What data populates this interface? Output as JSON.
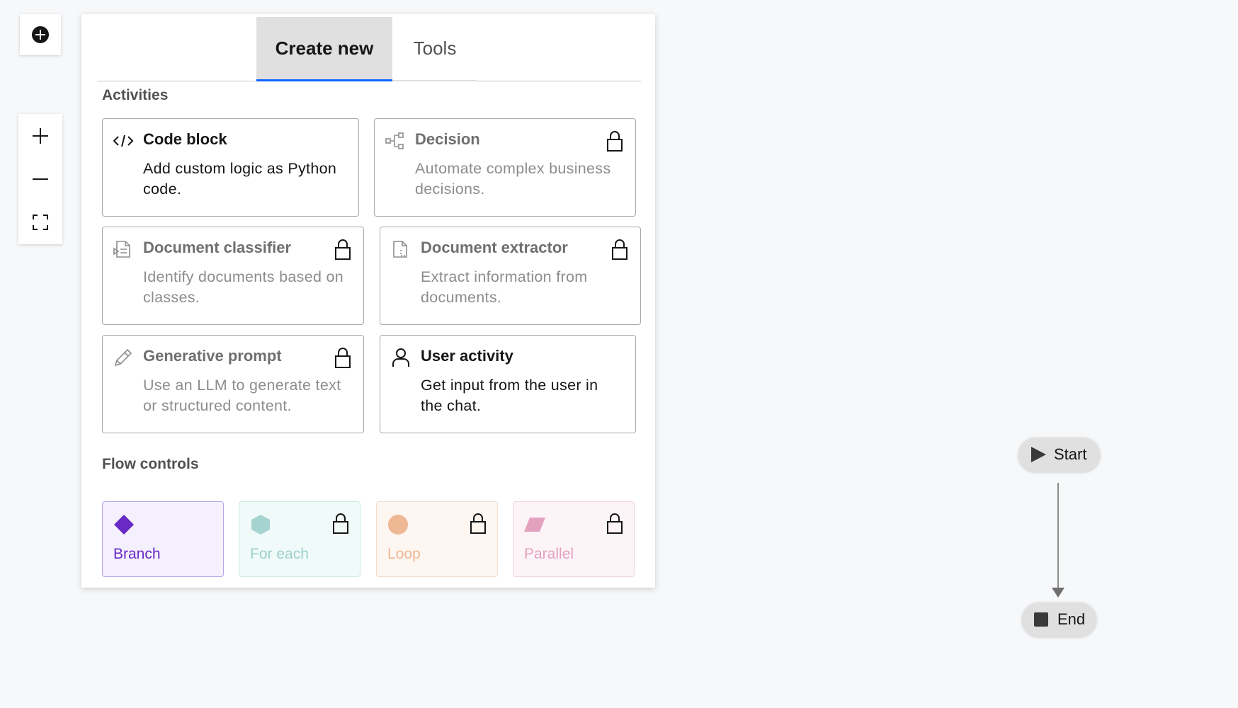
{
  "tabs": [
    {
      "label": "Create new",
      "active": true
    },
    {
      "label": "Tools",
      "active": false
    }
  ],
  "activities": {
    "title": "Activities",
    "cards": [
      {
        "icon": "code-icon",
        "title": "Code block",
        "description": "Add custom logic as Python code.",
        "locked": false
      },
      {
        "icon": "decision-tree-icon",
        "title": "Decision",
        "description": "Automate complex business decisions.",
        "locked": true
      },
      {
        "icon": "document-classifier-icon",
        "title": "Document classifier",
        "description": "Identify documents based on classes.",
        "locked": true
      },
      {
        "icon": "document-extractor-icon",
        "title": "Document extractor",
        "description": "Extract information from documents.",
        "locked": true
      },
      {
        "icon": "pencil-icon",
        "title": "Generative prompt",
        "description": "Use an LLM to generate text or structured content.",
        "locked": true
      },
      {
        "icon": "user-icon",
        "title": "User activity",
        "description": "Get input from the user in the chat.",
        "locked": false
      }
    ]
  },
  "flow_controls": {
    "title": "Flow controls",
    "items": [
      {
        "label": "Branch",
        "shape": "diamond-icon",
        "color": "#6929c4",
        "bg": "#f4f0fd",
        "border": "#b8a3e8",
        "locked": false
      },
      {
        "label": "For each",
        "shape": "hexagon-icon",
        "color": "#a5d3d0",
        "bg": "#effaf9",
        "border": "#cde9e6",
        "locked": true
      },
      {
        "label": "Loop",
        "shape": "circle-icon",
        "color": "#eeb894",
        "bg": "#fdf6f1",
        "border": "#f3dccc",
        "locked": true
      },
      {
        "label": "Parallel",
        "shape": "parallelogram-icon",
        "color": "#e3a1bf",
        "bg": "#fdf4f8",
        "border": "#f0d5e2",
        "locked": true
      }
    ]
  },
  "canvas": {
    "start_label": "Start",
    "end_label": "End"
  },
  "colors": {
    "accent": "#0f62fe",
    "panel_bg": "#ffffff",
    "canvas_bg": "#f7f8fa"
  }
}
